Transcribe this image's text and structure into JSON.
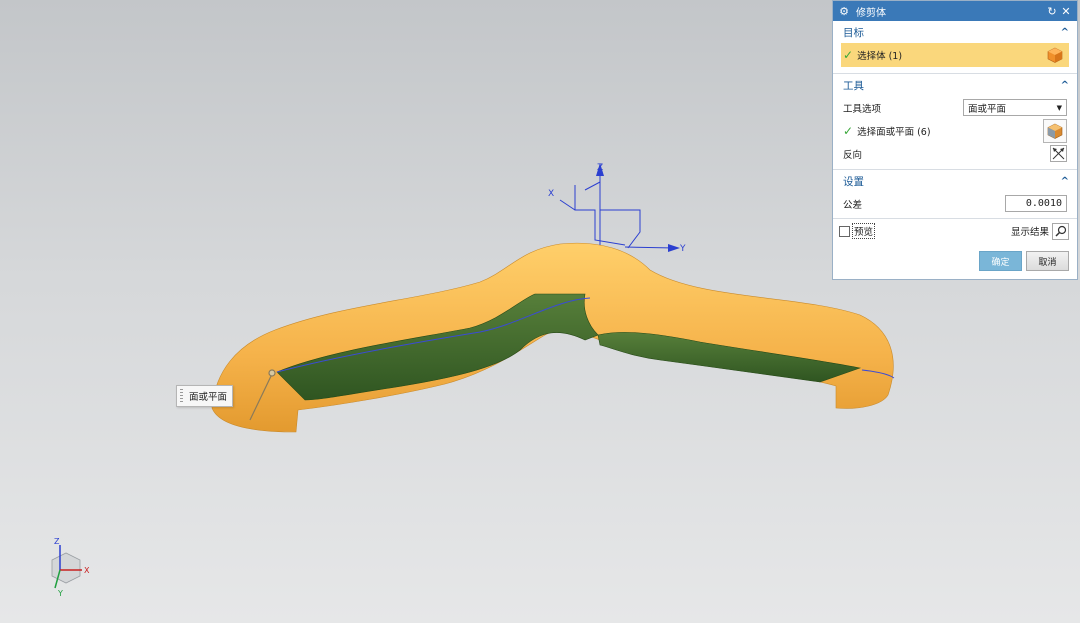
{
  "viewport": {
    "hint_label": "面或平面",
    "csys_labels": {
      "x": "X",
      "y": "Y",
      "z": "Z"
    },
    "triad_labels": {
      "x": "X",
      "y": "Y",
      "z": "Z"
    }
  },
  "dialog": {
    "title": "修剪体",
    "target": {
      "header": "目标",
      "select_body_label": "选择体 (1)"
    },
    "tool": {
      "header": "工具",
      "tool_option_label": "工具选项",
      "tool_option_value": "面或平面",
      "select_face_label": "选择面或平面 (6)",
      "reverse_label": "反向"
    },
    "settings": {
      "header": "设置",
      "tolerance_label": "公差",
      "tolerance_value": "0.0010"
    },
    "preview_label": "预览",
    "show_result_label": "显示结果",
    "ok_label": "确定",
    "cancel_label": "取消"
  },
  "colors": {
    "titlebar": "#3a79b8",
    "part_yellow": "#f6b94a",
    "cut_green": "#3e6b2a",
    "selected_row": "#fad77c",
    "ok_button": "#7ab6d8"
  }
}
